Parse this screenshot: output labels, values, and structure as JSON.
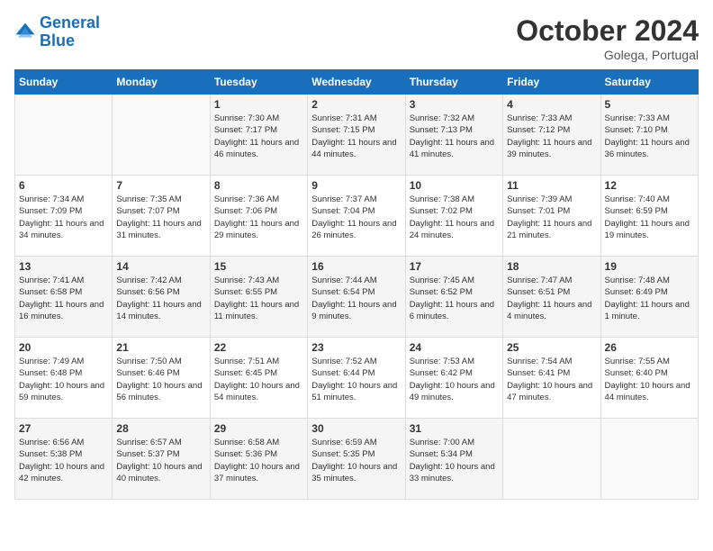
{
  "header": {
    "logo_line1": "General",
    "logo_line2": "Blue",
    "month": "October 2024",
    "location": "Golega, Portugal"
  },
  "weekdays": [
    "Sunday",
    "Monday",
    "Tuesday",
    "Wednesday",
    "Thursday",
    "Friday",
    "Saturday"
  ],
  "weeks": [
    [
      {
        "day": "",
        "info": ""
      },
      {
        "day": "",
        "info": ""
      },
      {
        "day": "1",
        "info": "Sunrise: 7:30 AM\nSunset: 7:17 PM\nDaylight: 11 hours and 46 minutes."
      },
      {
        "day": "2",
        "info": "Sunrise: 7:31 AM\nSunset: 7:15 PM\nDaylight: 11 hours and 44 minutes."
      },
      {
        "day": "3",
        "info": "Sunrise: 7:32 AM\nSunset: 7:13 PM\nDaylight: 11 hours and 41 minutes."
      },
      {
        "day": "4",
        "info": "Sunrise: 7:33 AM\nSunset: 7:12 PM\nDaylight: 11 hours and 39 minutes."
      },
      {
        "day": "5",
        "info": "Sunrise: 7:33 AM\nSunset: 7:10 PM\nDaylight: 11 hours and 36 minutes."
      }
    ],
    [
      {
        "day": "6",
        "info": "Sunrise: 7:34 AM\nSunset: 7:09 PM\nDaylight: 11 hours and 34 minutes."
      },
      {
        "day": "7",
        "info": "Sunrise: 7:35 AM\nSunset: 7:07 PM\nDaylight: 11 hours and 31 minutes."
      },
      {
        "day": "8",
        "info": "Sunrise: 7:36 AM\nSunset: 7:06 PM\nDaylight: 11 hours and 29 minutes."
      },
      {
        "day": "9",
        "info": "Sunrise: 7:37 AM\nSunset: 7:04 PM\nDaylight: 11 hours and 26 minutes."
      },
      {
        "day": "10",
        "info": "Sunrise: 7:38 AM\nSunset: 7:02 PM\nDaylight: 11 hours and 24 minutes."
      },
      {
        "day": "11",
        "info": "Sunrise: 7:39 AM\nSunset: 7:01 PM\nDaylight: 11 hours and 21 minutes."
      },
      {
        "day": "12",
        "info": "Sunrise: 7:40 AM\nSunset: 6:59 PM\nDaylight: 11 hours and 19 minutes."
      }
    ],
    [
      {
        "day": "13",
        "info": "Sunrise: 7:41 AM\nSunset: 6:58 PM\nDaylight: 11 hours and 16 minutes."
      },
      {
        "day": "14",
        "info": "Sunrise: 7:42 AM\nSunset: 6:56 PM\nDaylight: 11 hours and 14 minutes."
      },
      {
        "day": "15",
        "info": "Sunrise: 7:43 AM\nSunset: 6:55 PM\nDaylight: 11 hours and 11 minutes."
      },
      {
        "day": "16",
        "info": "Sunrise: 7:44 AM\nSunset: 6:54 PM\nDaylight: 11 hours and 9 minutes."
      },
      {
        "day": "17",
        "info": "Sunrise: 7:45 AM\nSunset: 6:52 PM\nDaylight: 11 hours and 6 minutes."
      },
      {
        "day": "18",
        "info": "Sunrise: 7:47 AM\nSunset: 6:51 PM\nDaylight: 11 hours and 4 minutes."
      },
      {
        "day": "19",
        "info": "Sunrise: 7:48 AM\nSunset: 6:49 PM\nDaylight: 11 hours and 1 minute."
      }
    ],
    [
      {
        "day": "20",
        "info": "Sunrise: 7:49 AM\nSunset: 6:48 PM\nDaylight: 10 hours and 59 minutes."
      },
      {
        "day": "21",
        "info": "Sunrise: 7:50 AM\nSunset: 6:46 PM\nDaylight: 10 hours and 56 minutes."
      },
      {
        "day": "22",
        "info": "Sunrise: 7:51 AM\nSunset: 6:45 PM\nDaylight: 10 hours and 54 minutes."
      },
      {
        "day": "23",
        "info": "Sunrise: 7:52 AM\nSunset: 6:44 PM\nDaylight: 10 hours and 51 minutes."
      },
      {
        "day": "24",
        "info": "Sunrise: 7:53 AM\nSunset: 6:42 PM\nDaylight: 10 hours and 49 minutes."
      },
      {
        "day": "25",
        "info": "Sunrise: 7:54 AM\nSunset: 6:41 PM\nDaylight: 10 hours and 47 minutes."
      },
      {
        "day": "26",
        "info": "Sunrise: 7:55 AM\nSunset: 6:40 PM\nDaylight: 10 hours and 44 minutes."
      }
    ],
    [
      {
        "day": "27",
        "info": "Sunrise: 6:56 AM\nSunset: 5:38 PM\nDaylight: 10 hours and 42 minutes."
      },
      {
        "day": "28",
        "info": "Sunrise: 6:57 AM\nSunset: 5:37 PM\nDaylight: 10 hours and 40 minutes."
      },
      {
        "day": "29",
        "info": "Sunrise: 6:58 AM\nSunset: 5:36 PM\nDaylight: 10 hours and 37 minutes."
      },
      {
        "day": "30",
        "info": "Sunrise: 6:59 AM\nSunset: 5:35 PM\nDaylight: 10 hours and 35 minutes."
      },
      {
        "day": "31",
        "info": "Sunrise: 7:00 AM\nSunset: 5:34 PM\nDaylight: 10 hours and 33 minutes."
      },
      {
        "day": "",
        "info": ""
      },
      {
        "day": "",
        "info": ""
      }
    ]
  ]
}
